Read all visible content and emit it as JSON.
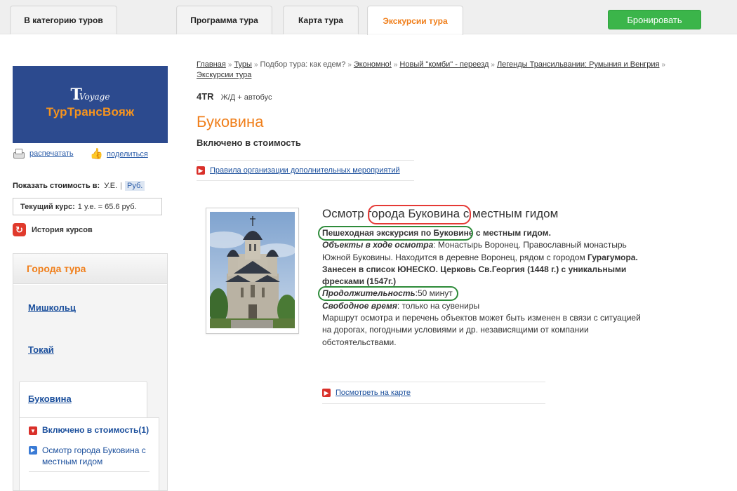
{
  "tabs": {
    "category": "В категорию туров",
    "program": "Программа тура",
    "map": "Карта тура",
    "excursions": "Экскурсии тура"
  },
  "book_button": "Бронировать",
  "logo": {
    "mark": "Voyage",
    "text": "ТурТрансВояж"
  },
  "utils": {
    "print": "распечатать",
    "share": "поделиться"
  },
  "price_display": {
    "label": "Показать стоимость в:",
    "option_ue": "У.Е.",
    "separator": "|",
    "option_rub": "Руб."
  },
  "current_rate": {
    "label": "Текущий курс:",
    "value": "1 у.е. = 65.6 руб."
  },
  "history_link": "История курсов",
  "cities": {
    "title": "Города тура",
    "items": [
      "Мишкольц",
      "Токай",
      "Буковина"
    ],
    "sub_items": [
      "Включено в стоимость(1)",
      "Осмотр города Буковина с местным гидом"
    ]
  },
  "breadcrumb": {
    "items": [
      {
        "text": "Главная",
        "link": true
      },
      {
        "text": "Туры",
        "link": true
      },
      {
        "text": "Подбор тура: как едем?",
        "link": false
      },
      {
        "text": "Экономно!",
        "link": true
      },
      {
        "text": "Новый \"комби\" - переезд",
        "link": true
      },
      {
        "text": "Легенды Трансильвании: Румыния и Венгрия",
        "link": true
      },
      {
        "text": "Экскурсии тура",
        "link": true
      }
    ],
    "separator": "»"
  },
  "tour": {
    "code": "4TR",
    "transport": "Ж/Д + автобус"
  },
  "page_title": "Буковина",
  "section_title": "Включено в стоимость",
  "rules_link": "Правила организации дополнительных мероприятий",
  "excursion": {
    "title": "Осмотр города Буковина с местным гидом",
    "line1_bold": "Пешеходная экскурсия по Буковине с местным гидом.",
    "objects_label": "Объекты в ходе осмотра",
    "objects_text": ": Монастырь Воронец. Православный монастырь Южной Буковины. Находится в деревне Воронец, рядом с городом ",
    "objects_bold": "Гурагумора. Занесен в список ЮНЕСКО. Церковь Св.Георгия (1448 г.) с уникальными фресками (1547г.)",
    "duration_label": "Продолжительность",
    "duration_value": ":50 минут",
    "free_label": "Свободное время",
    "free_value": ": только на сувениры",
    "note": "Маршрут осмотра и перечень объектов может быть изменен в связи с ситуацией на дорогах, погодными условиями и др. независящими от компании обстоятельствами."
  },
  "map_link": "Посмотреть на карте",
  "icons": {
    "print": "printer-icon",
    "share": "thumbs-up-icon",
    "history": "refresh-icon",
    "arrow": "arrow-right-icon",
    "check": "chevron-down-icon"
  },
  "colors": {
    "accent": "#f07f1b",
    "book": "#3bb54a",
    "link": "#1b4f9c",
    "annotation_red": "#e53935",
    "annotation_green": "#2e8b3a"
  }
}
